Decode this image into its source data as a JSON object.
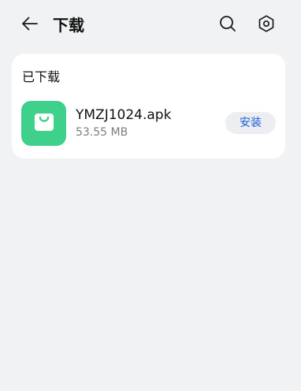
{
  "header": {
    "title": "下载",
    "back_icon": "arrow-left-icon",
    "search_icon": "search-icon",
    "settings_icon": "gear-icon"
  },
  "downloaded_section": {
    "title": "已下载",
    "items": [
      {
        "icon": "shopping-bag-icon",
        "icon_color": "#3fd18b",
        "name": "YMZJ1024.apk",
        "size": "53.55 MB",
        "action_label": "安装"
      }
    ]
  },
  "colors": {
    "background": "#f1f2f4",
    "card": "#ffffff",
    "accent": "#1b5fd6"
  }
}
